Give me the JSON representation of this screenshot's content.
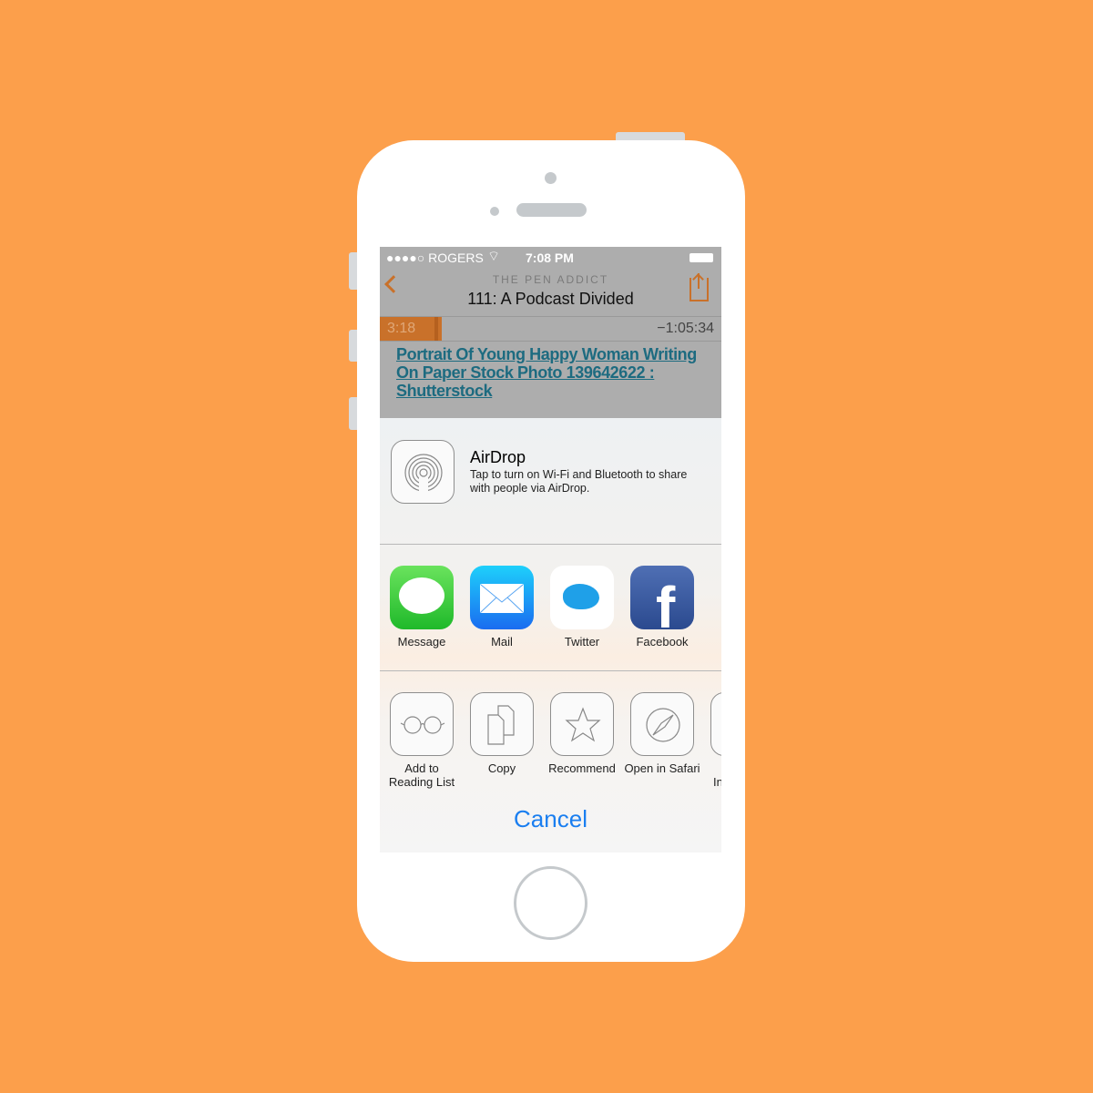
{
  "status": {
    "carrier": "●●●●○ ROGERS",
    "time": "7:08 PM"
  },
  "nav": {
    "podcast": "THE PEN ADDICT",
    "episode": "111: A Podcast Divided"
  },
  "player": {
    "elapsed": "3:18",
    "remaining": "−1:05:34",
    "progress": 0.05,
    "accent": "#c9712a"
  },
  "link": {
    "text": "Portrait Of Young Happy Woman Writing On Paper Stock Photo 139642622 : Shutterstock",
    "color": "#1d6b80"
  },
  "airdrop": {
    "title": "AirDrop",
    "desc": "Tap to turn on Wi-Fi and Bluetooth to share with people via AirDrop."
  },
  "share": [
    {
      "label": "Message"
    },
    {
      "label": "Mail"
    },
    {
      "label": "Twitter"
    },
    {
      "label": "Facebook"
    }
  ],
  "actions": [
    {
      "label": "Add to Reading List"
    },
    {
      "label": "Copy"
    },
    {
      "label": "Recommend"
    },
    {
      "label": "Open in Safari"
    },
    {
      "label": "In"
    }
  ],
  "cancel": "Cancel"
}
